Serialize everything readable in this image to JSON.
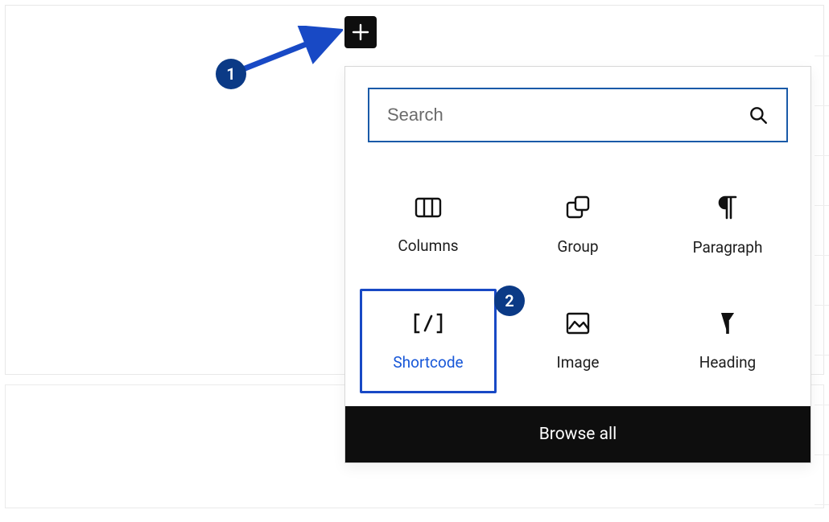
{
  "annotations": {
    "step1": "1",
    "step2": "2"
  },
  "inserter": {
    "search": {
      "placeholder": "Search"
    },
    "blocks": {
      "columns": {
        "label": "Columns"
      },
      "group": {
        "label": "Group"
      },
      "paragraph": {
        "label": "Paragraph"
      },
      "shortcode": {
        "label": "Shortcode",
        "selected": true
      },
      "image": {
        "label": "Image"
      },
      "heading": {
        "label": "Heading"
      }
    },
    "browse_all": "Browse all"
  },
  "colors": {
    "accent": "#1849c5",
    "badge": "#0b3a86",
    "black": "#0e0e0e"
  }
}
